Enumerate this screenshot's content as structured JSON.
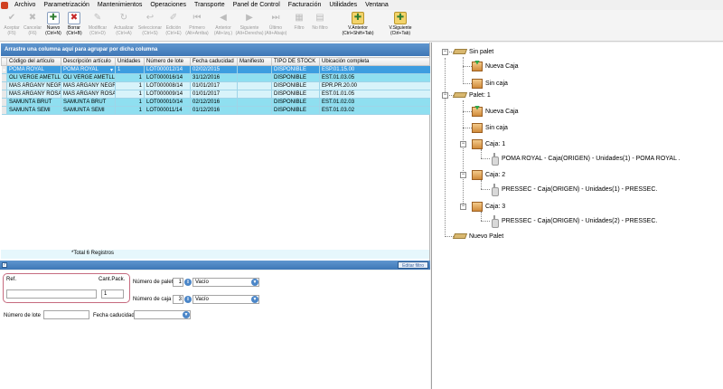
{
  "menu": [
    "Archivo",
    "Parametrización",
    "Mantenimientos",
    "Operaciones",
    "Transporte",
    "Panel de Control",
    "Facturación",
    "Utilidades",
    "Ventana"
  ],
  "toolbar": [
    {
      "label": "Aceptar",
      "shortcut": "(F5)",
      "icon": "check-icon",
      "enabled": false
    },
    {
      "label": "Cancelar",
      "shortcut": "(F6)",
      "icon": "cancel-icon",
      "enabled": false
    },
    {
      "label": "Nuevo",
      "shortcut": "(Ctrl+N)",
      "icon": "new-document-icon",
      "enabled": true
    },
    {
      "label": "Borrar",
      "shortcut": "(Ctrl+B)",
      "icon": "delete-icon",
      "enabled": true
    },
    {
      "label": "Modificar",
      "shortcut": "(Ctrl+D)",
      "icon": "edit-icon",
      "enabled": false
    },
    {
      "label": "Actualizar",
      "shortcut": "(Ctrl+A)",
      "icon": "refresh-icon",
      "enabled": false
    },
    {
      "label": "Seleccionar",
      "shortcut": "(Ctrl+S)",
      "icon": "select-icon",
      "enabled": false
    },
    {
      "label": "Edición",
      "shortcut": "(Ctrl+E)",
      "icon": "edition-icon",
      "enabled": false
    },
    {
      "label": "Primero",
      "shortcut": "(Alt+Arriba)",
      "icon": "first-icon",
      "enabled": false
    },
    {
      "label": "Anterior",
      "shortcut": "(Alt+Izq.)",
      "icon": "previous-icon",
      "enabled": false
    },
    {
      "label": "Siguiente",
      "shortcut": "(Alt+Derecha)",
      "icon": "next-icon",
      "enabled": false
    },
    {
      "label": "Último",
      "shortcut": "(Alt+Abajo)",
      "icon": "last-icon",
      "enabled": false
    },
    {
      "label": "Filtro",
      "shortcut": "",
      "icon": "filter-icon",
      "enabled": false
    },
    {
      "label": "No filtro",
      "shortcut": "",
      "icon": "no-filter-icon",
      "enabled": false
    },
    {
      "label": "V.Anterior",
      "shortcut": "(Ctrl+Shift+Tab)",
      "icon": "previous-window-icon",
      "enabled": true
    },
    {
      "label": "V.Siguiente",
      "shortcut": "(Ctrl+Tab)",
      "icon": "next-window-icon",
      "enabled": true
    }
  ],
  "grid": {
    "group_hint": "Arrastre una columna aquí para agrupar por dicha columna",
    "columns": [
      "Código del artículo",
      "Descripción artículo",
      "Unidades",
      "Número de lote",
      "Fecha caducidad",
      "Manifiesto",
      "TIPO DE STOCK",
      "Ubicación completa"
    ],
    "rows": [
      {
        "codigo": "POMA ROYAL",
        "descripcion": "POMA ROYAL",
        "unidades": "1",
        "lote": "LOT000012/14",
        "caducidad": "02/02/2015",
        "manifiesto": "",
        "tipo": "DISPONIBLE",
        "ubicacion": "ESP.01.15.00"
      },
      {
        "codigo": "OLI VERGE AMETLLER",
        "descripcion": "OLI VERGE AMETLLER",
        "unidades": "1",
        "lote": "LOT000016/14",
        "caducidad": "31/12/2016",
        "manifiesto": "",
        "tipo": "DISPONIBLE",
        "ubicacion": "EST.01.03.05"
      },
      {
        "codigo": "MAS ARGANY NEGRE",
        "descripcion": "MAS ARGANY NEGRE",
        "unidades": "1",
        "lote": "LOT000008/14",
        "caducidad": "01/01/2017",
        "manifiesto": "",
        "tipo": "DISPONIBLE",
        "ubicacion": "EPR.PR.20.00"
      },
      {
        "codigo": "MAS ARGANY ROSAT",
        "descripcion": "MAS ARGANY ROSAT",
        "unidades": "1",
        "lote": "LOT000009/14",
        "caducidad": "01/01/2017",
        "manifiesto": "",
        "tipo": "DISPONIBLE",
        "ubicacion": "EST.01.01.05"
      },
      {
        "codigo": "SAMUNTÀ BRUT",
        "descripcion": "SAMUNTÀ BRUT",
        "unidades": "1",
        "lote": "LOT000010/14",
        "caducidad": "02/12/2016",
        "manifiesto": "",
        "tipo": "DISPONIBLE",
        "ubicacion": "EST.01.02.03"
      },
      {
        "codigo": "SAMUNTÀ SEMI",
        "descripcion": "SAMUNTÀ SEMI",
        "unidades": "1",
        "lote": "LOT000011/14",
        "caducidad": "01/12/2016",
        "manifiesto": "",
        "tipo": "DISPONIBLE",
        "ubicacion": "EST.01.03.02"
      }
    ],
    "total": "*Total 6 Registros",
    "filter_button": "Editar filtro",
    "filter_check": "✓"
  },
  "form": {
    "ref_label": "Ref.",
    "ref_value": "",
    "cant_label": "Cant.Pack.",
    "cant_value": "1",
    "palet_label": "Número de palet",
    "palet_value": "1",
    "palet_combo": "Vacío",
    "caja_label": "Número de caja",
    "caja_value": "3",
    "caja_combo": "Vacío",
    "lote_label": "Número de lote",
    "lote_value": "",
    "caducidad_label": "Fecha caducidad",
    "caducidad_value": ""
  },
  "tree": {
    "sin_palet": "Sin palet",
    "nueva_caja": "Nueva Caja",
    "sin_caja": "Sin caja",
    "palet1": "Palet: 1",
    "caja1": "Caja: 1",
    "caja1_item": "POMA ROYAL - Caja(ORIGEN) - Unidades(1) - POMA ROYAL .",
    "caja2": "Caja: 2",
    "caja2_item": "PRESSEC - Caja(ORIGEN) - Unidades(1) - PRESSEC.",
    "caja3": "Caja: 3",
    "caja3_item": "PRESSEC - Caja(ORIGEN) - Unidades(2) - PRESSEC.",
    "nuevo_palet": "Nuevo Palet"
  },
  "colors": {
    "selected_row": "#3d9de0",
    "cyan_row": "#8fdff0",
    "header_blue": "#4a84c2"
  }
}
